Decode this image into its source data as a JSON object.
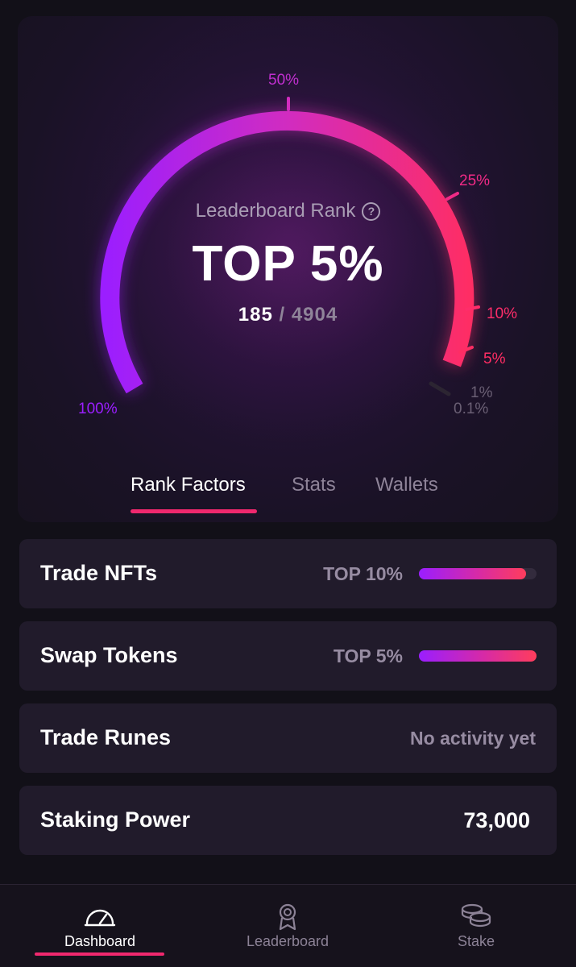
{
  "gauge": {
    "title": "Leaderboard Rank",
    "rank_text": "TOP 5%",
    "position": "185",
    "separator": "/",
    "total": "4904",
    "tick_labels": {
      "t100": "100%",
      "t50": "50%",
      "t25": "25%",
      "t10": "10%",
      "t5": "5%",
      "t1": "1%",
      "t01": "0.1%"
    },
    "colors": {
      "start": "#9b1eff",
      "mid": "#d42fb4",
      "end": "#ff2d6a",
      "inactive": "#6a5f74"
    }
  },
  "tabs": [
    {
      "label": "Rank Factors",
      "active": true
    },
    {
      "label": "Stats",
      "active": false
    },
    {
      "label": "Wallets",
      "active": false
    }
  ],
  "factors": [
    {
      "name": "Trade NFTs",
      "level": "TOP 10%",
      "progress": 0.91
    },
    {
      "name": "Swap Tokens",
      "level": "TOP 5%",
      "progress": 1.0
    },
    {
      "name": "Trade Runes",
      "status": "No activity yet"
    },
    {
      "name": "Staking Power",
      "value": "73,000"
    }
  ],
  "nav": [
    {
      "label": "Dashboard",
      "icon": "speedometer-icon",
      "active": true
    },
    {
      "label": "Leaderboard",
      "icon": "award-ribbon-icon",
      "active": false
    },
    {
      "label": "Stake",
      "icon": "coin-stack-icon",
      "active": false
    }
  ],
  "accent": "#f0286e"
}
